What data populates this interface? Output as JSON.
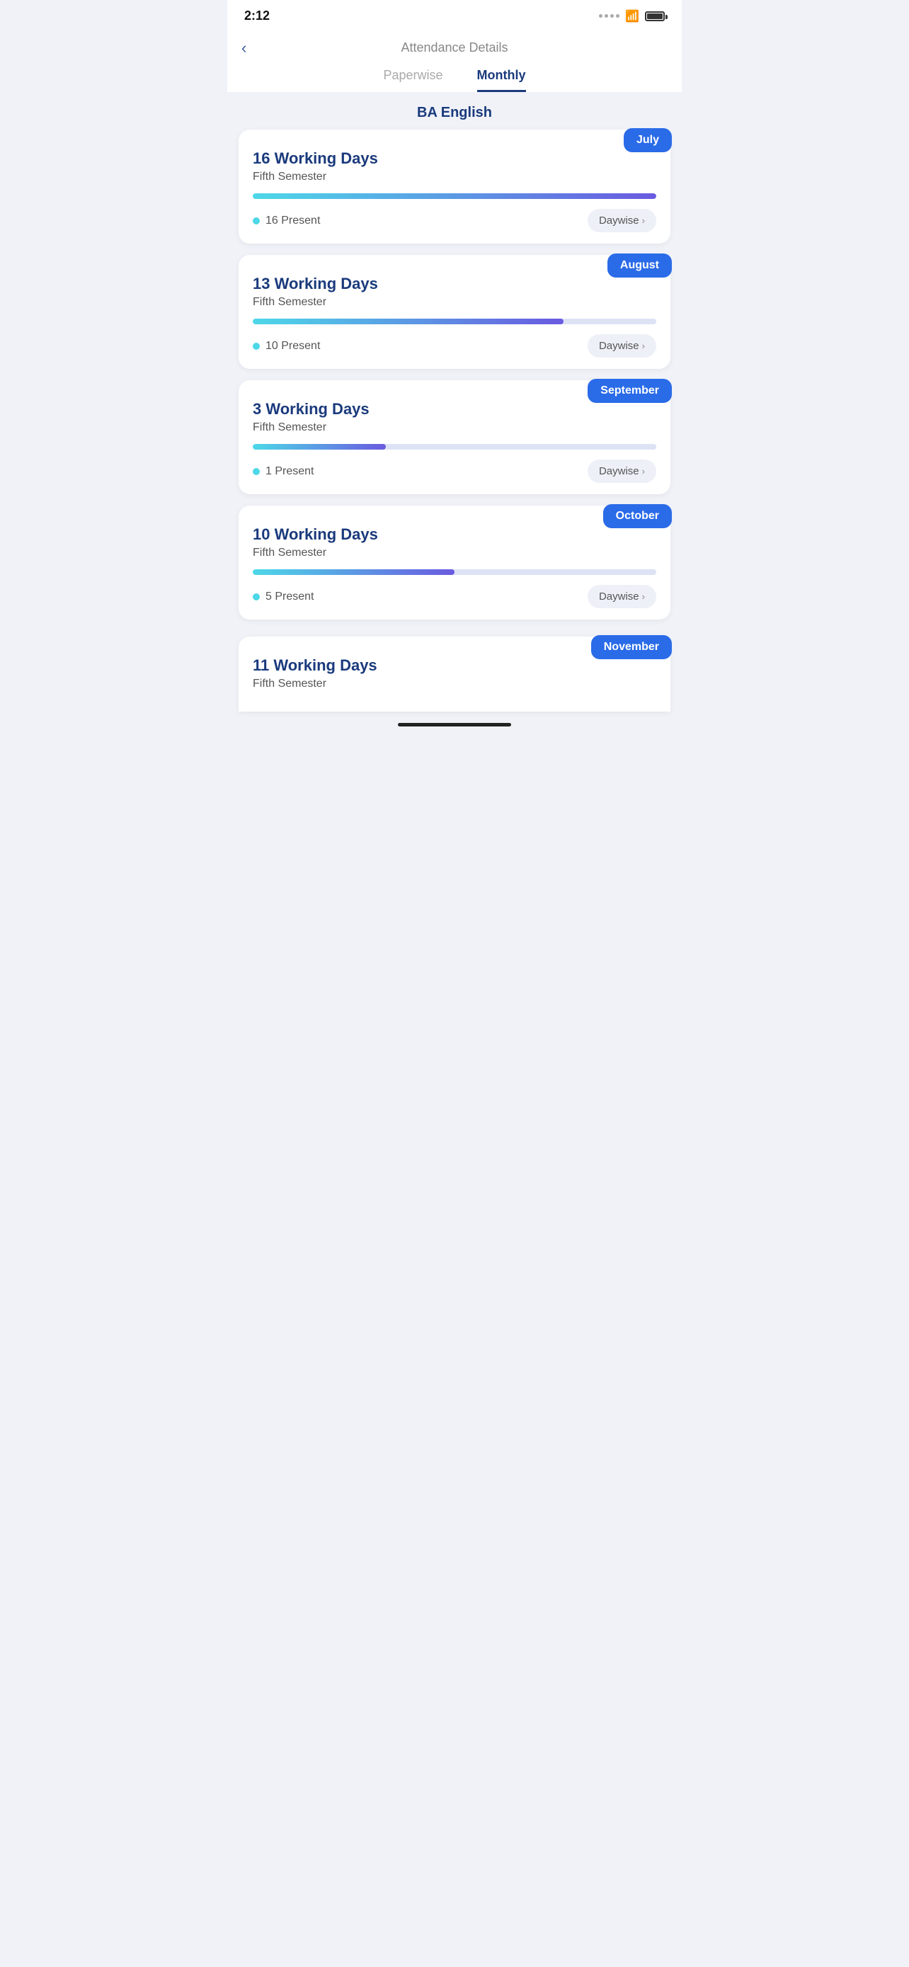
{
  "statusBar": {
    "time": "2:12"
  },
  "header": {
    "backLabel": "<",
    "title": "Attendance Details"
  },
  "tabs": [
    {
      "id": "paperwise",
      "label": "Paperwise",
      "active": false
    },
    {
      "id": "monthly",
      "label": "Monthly",
      "active": true
    }
  ],
  "sectionTitle": "BA English",
  "months": [
    {
      "month": "July",
      "workingDays": "16 Working Days",
      "semester": "Fifth Semester",
      "present": "16 Present",
      "progressPercent": 100,
      "daywiseLabel": "Daywise"
    },
    {
      "month": "August",
      "workingDays": "13 Working Days",
      "semester": "Fifth Semester",
      "present": "10 Present",
      "progressPercent": 77,
      "daywiseLabel": "Daywise"
    },
    {
      "month": "September",
      "workingDays": "3 Working Days",
      "semester": "Fifth Semester",
      "present": "1 Present",
      "progressPercent": 33,
      "daywiseLabel": "Daywise"
    },
    {
      "month": "October",
      "workingDays": "10 Working Days",
      "semester": "Fifth Semester",
      "present": "5 Present",
      "progressPercent": 50,
      "daywiseLabel": "Daywise"
    }
  ],
  "partialMonth": {
    "month": "November",
    "workingDays": "11 Working Days",
    "semester": "Fifth Semester"
  }
}
